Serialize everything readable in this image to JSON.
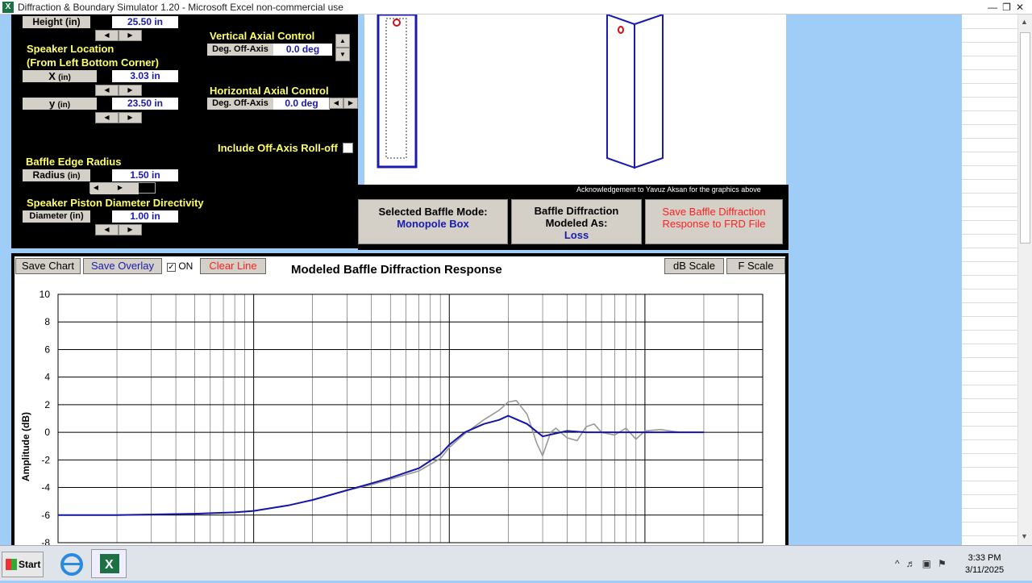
{
  "window": {
    "title": "Diffraction & Boundary Simulator 1.20 - Microsoft Excel non-commercial use",
    "app_icon": "X"
  },
  "controls": {
    "height": {
      "label": "Height (in)",
      "value": "25.50 in"
    },
    "speaker_location_title": "Speaker Location",
    "speaker_location_sub": "(From Left Bottom Corner)",
    "x": {
      "label_main": "X",
      "label_unit": "(in)",
      "value": "3.03 in"
    },
    "y": {
      "label_main": "y",
      "label_unit": "(in)",
      "value": "23.50 in"
    },
    "vertical": {
      "title": "Vertical Axial Control",
      "label": "Deg. Off-Axis",
      "value": "0.0 deg"
    },
    "horizontal": {
      "title": "Horizontal Axial Control",
      "label": "Deg. Off-Axis",
      "value": "0.0 deg"
    },
    "rolloff": {
      "label": "Include Off-Axis Roll-off"
    },
    "edge": {
      "title": "Baffle Edge Radius",
      "label": "Radius",
      "label_unit": "(in)",
      "value": "1.50 in"
    },
    "piston": {
      "title": "Speaker Piston Diameter Directivity",
      "label": "Diameter (in)",
      "value": "1.00 in"
    }
  },
  "ack": "Acknowledgement to Yavuz Aksan for the graphics above",
  "mode": {
    "selected_label": "Selected Baffle Mode:",
    "selected_value": "Monopole Box",
    "modeled_label1": "Baffle Diffraction",
    "modeled_label2": "Modeled As:",
    "modeled_value": "Loss",
    "save_frd1": "Save Baffle Diffraction",
    "save_frd2": "Response  to FRD File"
  },
  "chart_toolbar": {
    "save_chart": "Save Chart",
    "save_overlay": "Save Overlay",
    "on": "ON",
    "clear_line": "Clear Line",
    "db_scale": "dB Scale",
    "f_scale": "F Scale"
  },
  "colors": {
    "response": "#1515a8",
    "overlay": "#999999",
    "clear_line": "#ff2020",
    "mode_value": "#1a1ab0"
  },
  "chart_data": {
    "type": "line",
    "title": "Modeled Baffle Diffraction Response",
    "ylabel": "Amplitude (dB)",
    "xlabel": "",
    "ylim": [
      -8,
      10
    ],
    "yticks": [
      10,
      8,
      6,
      4,
      2,
      0,
      -2,
      -4,
      -6,
      -8
    ],
    "xscale": "log",
    "xlim": [
      10,
      40000
    ],
    "grid": true,
    "series": [
      {
        "values_x": [
          10,
          20,
          50,
          80,
          100,
          150,
          200,
          300,
          400,
          500,
          700,
          900,
          1000,
          1200,
          1500,
          1800,
          2000,
          2500,
          3000,
          4000,
          5000,
          7000,
          10000,
          15000,
          20000
        ],
        "values": [
          -6,
          -6,
          -5.9,
          -5.8,
          -5.7,
          -5.3,
          -4.9,
          -4.2,
          -3.7,
          -3.3,
          -2.6,
          -1.6,
          -0.9,
          0,
          0.6,
          0.9,
          1.2,
          0.6,
          -0.3,
          0.1,
          0,
          0,
          0,
          0,
          0
        ]
      },
      {
        "values_x": [
          10,
          20,
          50,
          80,
          100,
          150,
          200,
          300,
          400,
          500,
          700,
          900,
          1000,
          1200,
          1500,
          1800,
          2000,
          2200,
          2500,
          2800,
          3000,
          3300,
          3500,
          4000,
          4500,
          5000,
          5500,
          6000,
          7000,
          8000,
          9000,
          10000,
          12000,
          15000
        ],
        "values": [
          -6,
          -6,
          -5.9,
          -5.8,
          -5.7,
          -5.3,
          -4.9,
          -4.2,
          -3.8,
          -3.4,
          -2.8,
          -1.9,
          -1.1,
          -0.1,
          0.9,
          1.6,
          2.2,
          2.3,
          1.3,
          -0.8,
          -1.7,
          0,
          0.3,
          -0.4,
          -0.6,
          0.4,
          0.6,
          0,
          -0.2,
          0.3,
          -0.5,
          0.1,
          0.2,
          0
        ]
      }
    ]
  }
}
